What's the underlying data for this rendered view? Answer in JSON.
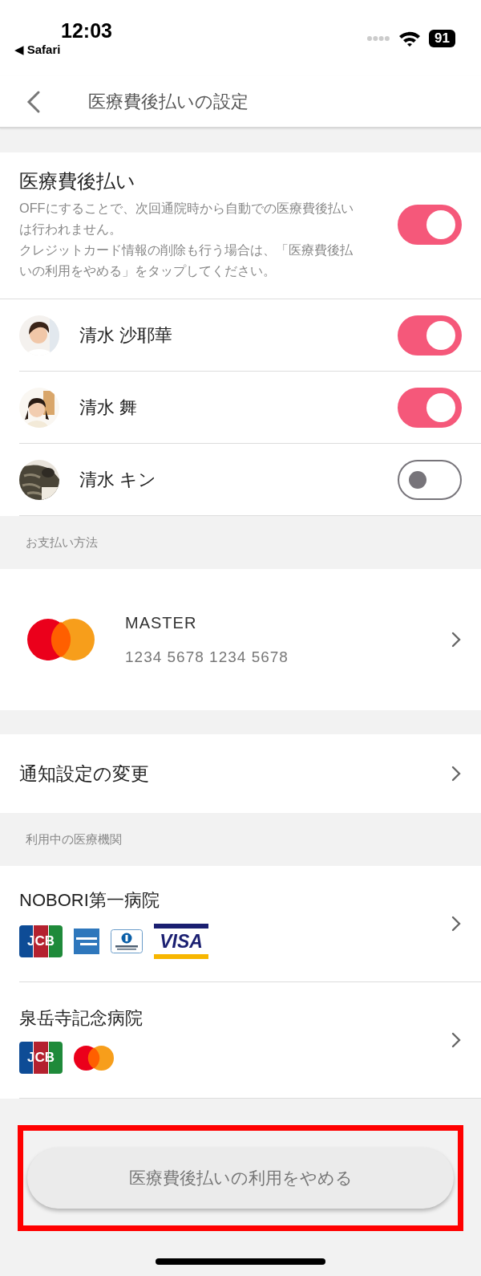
{
  "status_bar": {
    "time": "12:03",
    "back_app": "◀ Safari",
    "battery": "91"
  },
  "header": {
    "title": "医療費後払いの設定"
  },
  "deferred_payment": {
    "title": "医療費後払い",
    "description": [
      "OFFにすることで、次回通院時から自動での医療費後払いは行われません。",
      "クレジットカード情報の削除も行う場合は、「医療費後払いの利用をやめる」をタップしてください。"
    ],
    "on": true
  },
  "members": [
    {
      "name": "清水 沙耶華",
      "on": true,
      "kind": "adult"
    },
    {
      "name": "清水 舞",
      "on": true,
      "kind": "child"
    },
    {
      "name": "清水 キン",
      "on": false,
      "kind": "cat"
    }
  ],
  "payment": {
    "section_label": "お支払い方法",
    "brand": "MASTER",
    "number": "1234 5678 1234 5678"
  },
  "notification": {
    "label": "通知設定の変更"
  },
  "institutions": {
    "section_label": "利用中の医療機関",
    "items": [
      {
        "name": "NOBORI第一病院",
        "cards": [
          {
            "kind": "jcb",
            "label": "JCB"
          },
          {
            "kind": "amex"
          },
          {
            "kind": "diners"
          },
          {
            "kind": "visa",
            "label": "VISA"
          }
        ]
      },
      {
        "name": "泉岳寺記念病院",
        "cards": [
          {
            "kind": "jcb",
            "label": "JCB"
          },
          {
            "kind": "mastercard"
          }
        ]
      }
    ]
  },
  "stop_button": {
    "label": "医療費後払いの利用をやめる",
    "highlighted": true
  }
}
